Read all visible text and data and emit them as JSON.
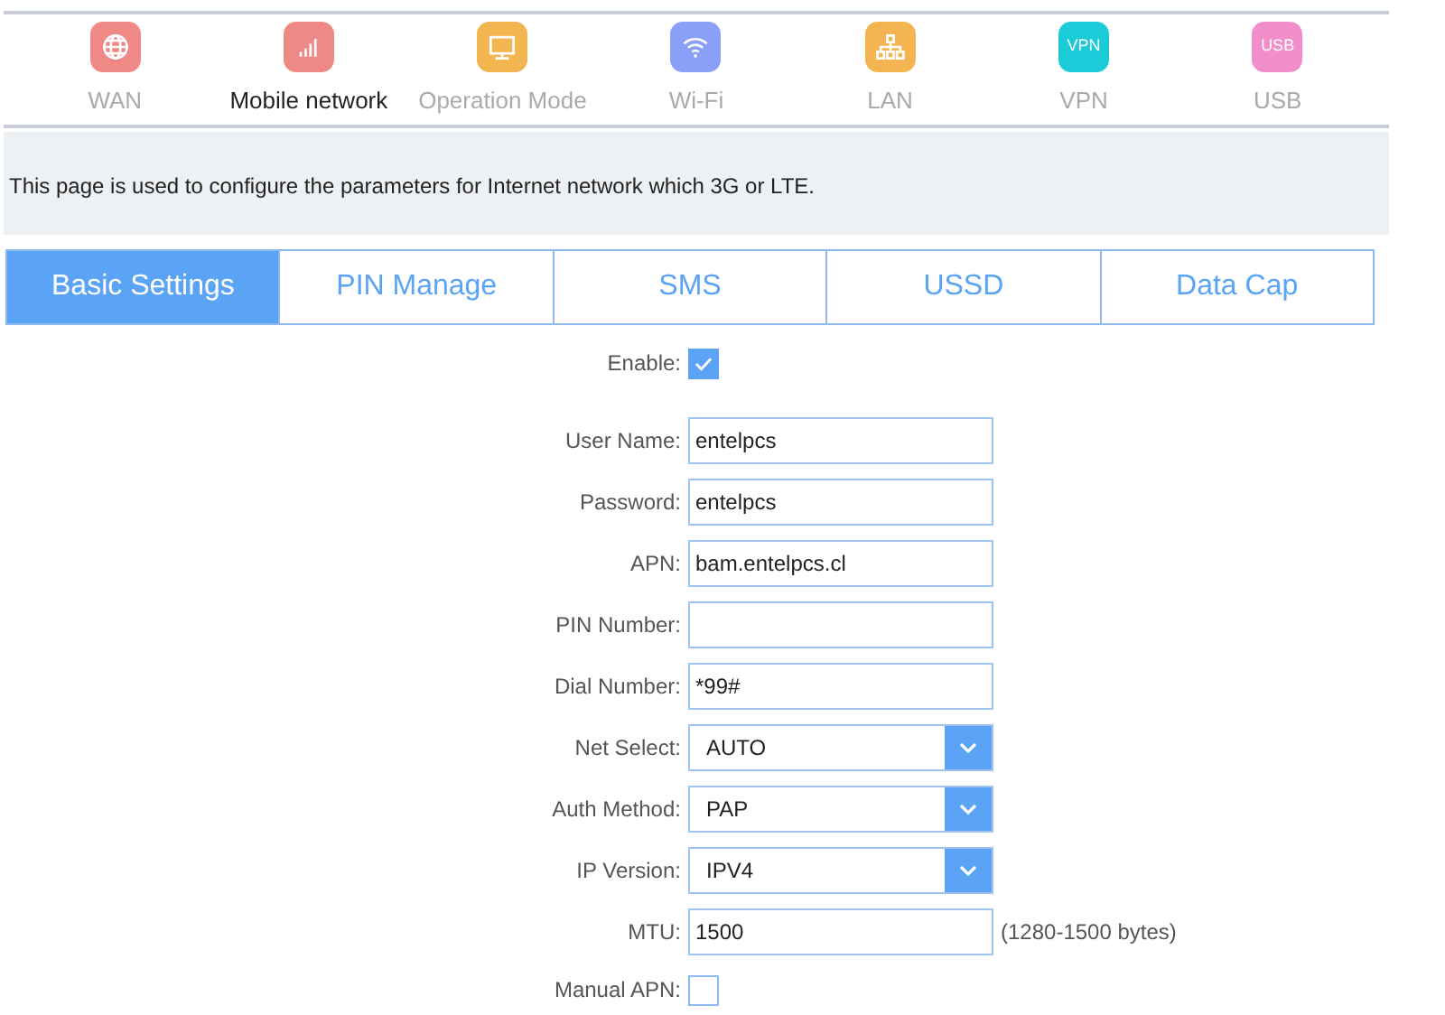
{
  "modules": [
    {
      "label": "WAN",
      "kind": "globe",
      "color": "#ee8985",
      "selected": false
    },
    {
      "label": "Mobile network",
      "kind": "signal",
      "color": "#ef8986",
      "selected": true
    },
    {
      "label": "Operation Mode",
      "kind": "monitor",
      "color": "#f3b550",
      "selected": false
    },
    {
      "label": "Wi-Fi",
      "kind": "wifi",
      "color": "#8a9ff8",
      "selected": false
    },
    {
      "label": "LAN",
      "kind": "lan",
      "color": "#f4b452",
      "selected": false
    },
    {
      "label": "VPN",
      "kind": "text",
      "tile_text": "VPN",
      "color": "#1ccbd8",
      "selected": false
    },
    {
      "label": "USB",
      "kind": "text",
      "tile_text": "USB",
      "color": "#f28fcb",
      "selected": false
    }
  ],
  "description": "This page is used to configure the parameters for Internet network which 3G or LTE.",
  "tabs": [
    {
      "label": "Basic Settings",
      "selected": true
    },
    {
      "label": "PIN Manage",
      "selected": false
    },
    {
      "label": "SMS",
      "selected": false
    },
    {
      "label": "USSD",
      "selected": false
    },
    {
      "label": "Data Cap",
      "selected": false
    }
  ],
  "form": [
    {
      "kind": "checkbox",
      "label": "Enable:",
      "checked": true
    },
    {
      "kind": "text",
      "label": "User Name:",
      "value": "entelpcs"
    },
    {
      "kind": "text",
      "label": "Password:",
      "value": "entelpcs"
    },
    {
      "kind": "text",
      "label": "APN:",
      "value": "bam.entelpcs.cl"
    },
    {
      "kind": "text",
      "label": "PIN Number:"
    },
    {
      "kind": "text",
      "label": "Dial Number:",
      "value": "*99#"
    },
    {
      "kind": "select",
      "label": "Net Select:",
      "value": "AUTO"
    },
    {
      "kind": "select",
      "label": "Auth Method:",
      "value": "PAP"
    },
    {
      "kind": "select",
      "label": "IP Version:",
      "value": "IPV4"
    },
    {
      "kind": "text",
      "label": "MTU:",
      "value": "1500",
      "hint": "(1280-1500 bytes)"
    },
    {
      "kind": "checkbox",
      "label": "Manual APN:",
      "checked": false
    }
  ]
}
